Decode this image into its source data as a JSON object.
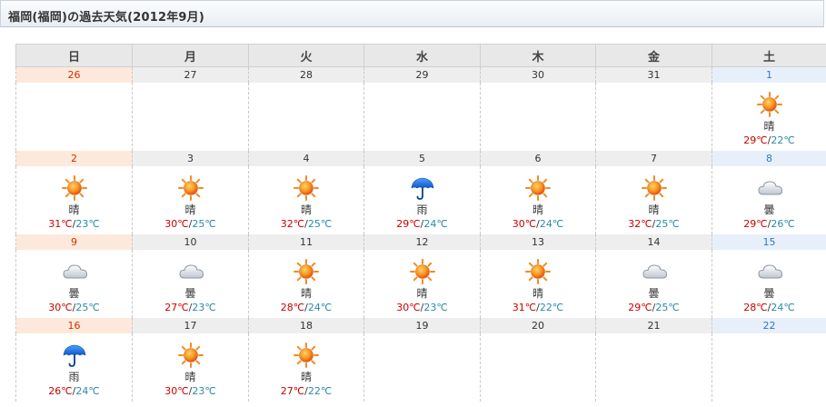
{
  "header": {
    "title": "福岡(福岡)の過去天気(2012年9月)"
  },
  "weekdays": [
    {
      "label": "日",
      "kind": "sun"
    },
    {
      "label": "月",
      "kind": "wk"
    },
    {
      "label": "火",
      "kind": "wk"
    },
    {
      "label": "水",
      "kind": "wk"
    },
    {
      "label": "木",
      "kind": "wk"
    },
    {
      "label": "金",
      "kind": "wk"
    },
    {
      "label": "土",
      "kind": "sat"
    }
  ],
  "colors": {
    "sunday": "#cc0000",
    "saturday": "#2f78c4",
    "high_temp": "#cc0000",
    "low_temp": "#2a8aa8"
  },
  "weeks": [
    [
      {
        "date": "26"
      },
      {
        "date": "27"
      },
      {
        "date": "28"
      },
      {
        "date": "29"
      },
      {
        "date": "30"
      },
      {
        "date": "31"
      },
      {
        "date": "1",
        "icon": "sun-icon",
        "cond": "晴",
        "hi": "29℃",
        "lo": "22℃"
      }
    ],
    [
      {
        "date": "2",
        "icon": "sun-icon",
        "cond": "晴",
        "hi": "31℃",
        "lo": "23℃"
      },
      {
        "date": "3",
        "icon": "sun-icon",
        "cond": "晴",
        "hi": "30℃",
        "lo": "25℃"
      },
      {
        "date": "4",
        "icon": "sun-icon",
        "cond": "晴",
        "hi": "32℃",
        "lo": "25℃"
      },
      {
        "date": "5",
        "icon": "umbrella-icon",
        "cond": "雨",
        "hi": "29℃",
        "lo": "24℃"
      },
      {
        "date": "6",
        "icon": "sun-icon",
        "cond": "晴",
        "hi": "30℃",
        "lo": "24℃"
      },
      {
        "date": "7",
        "icon": "sun-icon",
        "cond": "晴",
        "hi": "32℃",
        "lo": "25℃"
      },
      {
        "date": "8",
        "icon": "cloud-icon",
        "cond": "曇",
        "hi": "29℃",
        "lo": "26℃"
      }
    ],
    [
      {
        "date": "9",
        "icon": "cloud-icon",
        "cond": "曇",
        "hi": "30℃",
        "lo": "25℃"
      },
      {
        "date": "10",
        "icon": "cloud-icon",
        "cond": "曇",
        "hi": "27℃",
        "lo": "23℃"
      },
      {
        "date": "11",
        "icon": "sun-icon",
        "cond": "晴",
        "hi": "28℃",
        "lo": "24℃"
      },
      {
        "date": "12",
        "icon": "sun-icon",
        "cond": "晴",
        "hi": "30℃",
        "lo": "23℃"
      },
      {
        "date": "13",
        "icon": "sun-icon",
        "cond": "晴",
        "hi": "31℃",
        "lo": "22℃"
      },
      {
        "date": "14",
        "icon": "cloud-icon",
        "cond": "曇",
        "hi": "29℃",
        "lo": "25℃"
      },
      {
        "date": "15",
        "icon": "cloud-icon",
        "cond": "曇",
        "hi": "28℃",
        "lo": "24℃"
      }
    ],
    [
      {
        "date": "16",
        "icon": "umbrella-icon",
        "cond": "雨",
        "hi": "26℃",
        "lo": "24℃"
      },
      {
        "date": "17",
        "icon": "sun-icon",
        "cond": "晴",
        "hi": "30℃",
        "lo": "23℃"
      },
      {
        "date": "18",
        "icon": "sun-icon",
        "cond": "晴",
        "hi": "27℃",
        "lo": "22℃"
      },
      {
        "date": "19"
      },
      {
        "date": "20"
      },
      {
        "date": "21"
      },
      {
        "date": "22"
      }
    ]
  ]
}
